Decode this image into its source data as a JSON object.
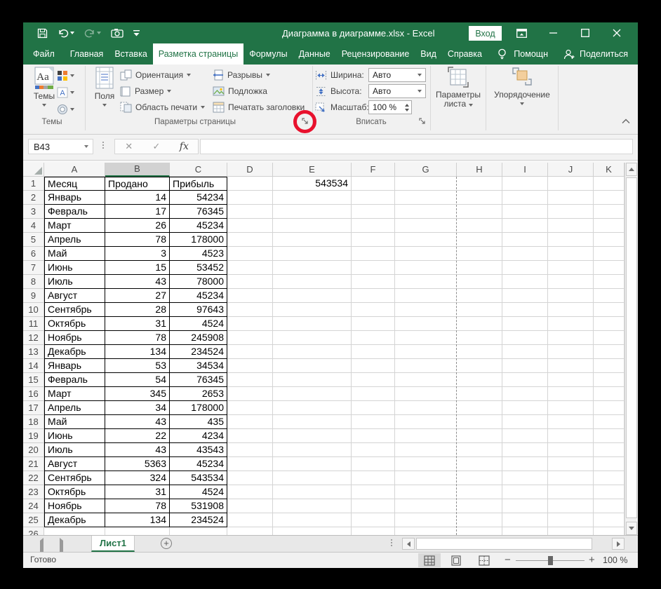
{
  "titlebar": {
    "title": "Диаграмма в диаграмме.xlsx  -  Excel",
    "signin": "Вход"
  },
  "ribbon_tabs": {
    "items": [
      {
        "label": "Файл",
        "active": false
      },
      {
        "label": "Главная",
        "active": false
      },
      {
        "label": "Вставка",
        "active": false
      },
      {
        "label": "Разметка страницы",
        "active": true
      },
      {
        "label": "Формулы",
        "active": false
      },
      {
        "label": "Данные",
        "active": false
      },
      {
        "label": "Рецензирование",
        "active": false
      },
      {
        "label": "Вид",
        "active": false
      },
      {
        "label": "Справка",
        "active": false
      }
    ],
    "assistant": "Помощн",
    "share": "Поделиться"
  },
  "ribbon": {
    "themes": {
      "button": "Темы",
      "group_label": "Темы",
      "fonts_glyph": "А"
    },
    "page_setup": {
      "margins": "Поля",
      "orientation": "Ориентация",
      "size": "Размер",
      "print_area": "Область печати",
      "breaks": "Разрывы",
      "watermark": "Подложка",
      "print_titles": "Печатать заголовки",
      "group_label": "Параметры страницы"
    },
    "fit": {
      "width_label": "Ширина:",
      "width_value": "Авто",
      "height_label": "Высота:",
      "height_value": "Авто",
      "scale_label": "Масштаб:",
      "scale_value": "100 %",
      "group_label": "Вписать"
    },
    "sheet_options_line1": "Параметры",
    "sheet_options_line2": "листа",
    "arrange": "Упорядочение"
  },
  "formula_bar": {
    "name_box": "B43",
    "fx": "fx",
    "cancel": "✕",
    "enter": "✓"
  },
  "spreadsheet": {
    "columns": [
      "A",
      "B",
      "C",
      "D",
      "E",
      "F",
      "G",
      "H",
      "I",
      "J",
      "K"
    ],
    "selected_column": "B",
    "page_break_after_column": "G",
    "e1_value": "543534",
    "rows": [
      [
        "Месяц",
        "Продано",
        "Прибыль"
      ],
      [
        "Январь",
        "14",
        "54234"
      ],
      [
        "Февраль",
        "17",
        "76345"
      ],
      [
        "Март",
        "26",
        "45234"
      ],
      [
        "Апрель",
        "78",
        "178000"
      ],
      [
        "Май",
        "3",
        "4523"
      ],
      [
        "Июнь",
        "15",
        "53452"
      ],
      [
        "Июль",
        "43",
        "78000"
      ],
      [
        "Август",
        "27",
        "45234"
      ],
      [
        "Сентябрь",
        "28",
        "97643"
      ],
      [
        "Октябрь",
        "31",
        "4524"
      ],
      [
        "Ноябрь",
        "78",
        "245908"
      ],
      [
        "Декабрь",
        "134",
        "234524"
      ],
      [
        "Январь",
        "53",
        "34534"
      ],
      [
        "Февраль",
        "54",
        "76345"
      ],
      [
        "Март",
        "345",
        "2653"
      ],
      [
        "Апрель",
        "34",
        "178000"
      ],
      [
        "Май",
        "43",
        "435"
      ],
      [
        "Июнь",
        "22",
        "4234"
      ],
      [
        "Июль",
        "43",
        "43543"
      ],
      [
        "Август",
        "5363",
        "45234"
      ],
      [
        "Сентябрь",
        "324",
        "543534"
      ],
      [
        "Октябрь",
        "31",
        "4524"
      ],
      [
        "Ноябрь",
        "78",
        "531908"
      ],
      [
        "Декабрь",
        "134",
        "234524"
      ]
    ]
  },
  "sheet_tabs": {
    "active_tab": "Лист1"
  },
  "status_bar": {
    "ready": "Готово",
    "zoom_level": "100 %"
  },
  "colors": {
    "accent_green": "#217346",
    "annotation_red": "#e8112d"
  }
}
